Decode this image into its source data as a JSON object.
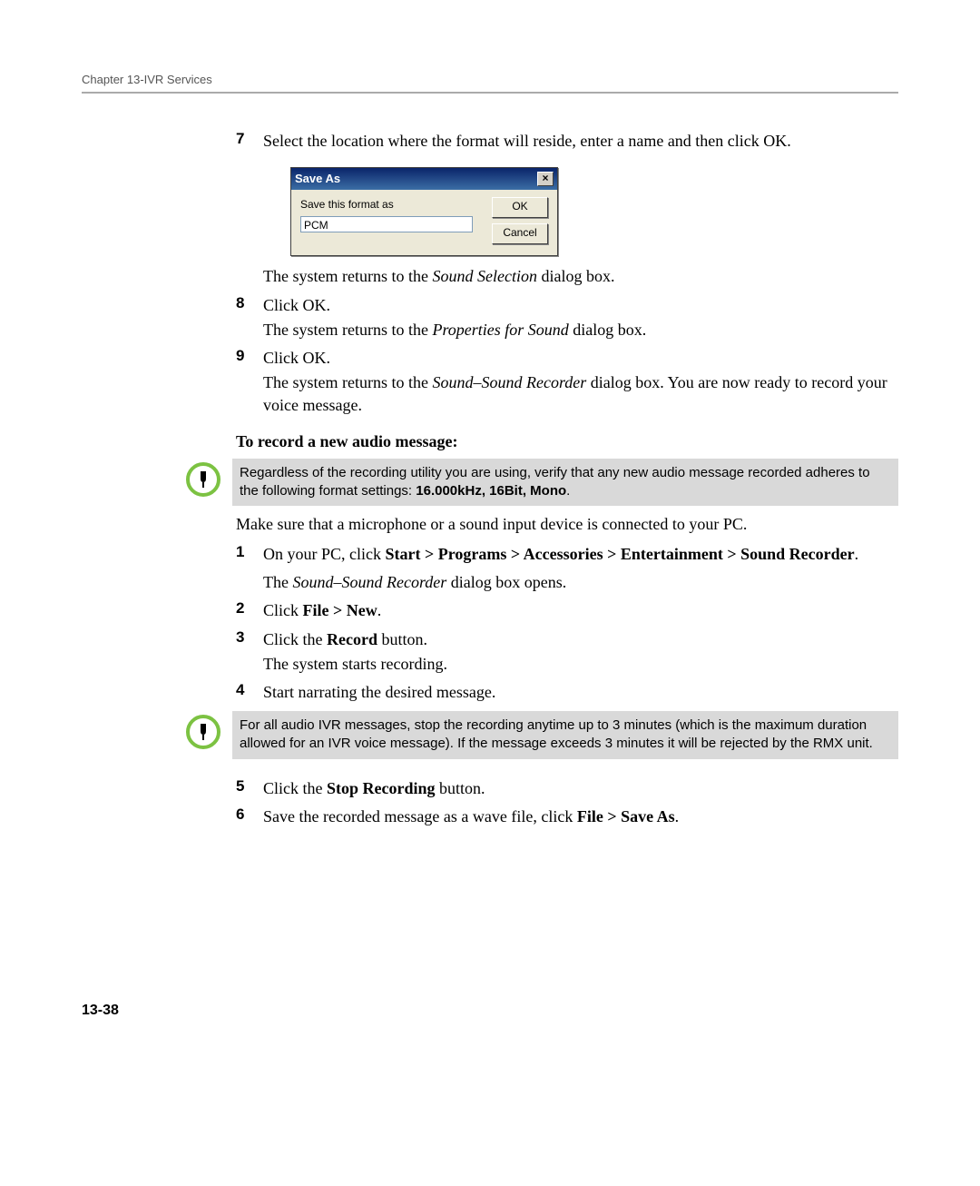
{
  "header": "Chapter 13-IVR Services",
  "step7": {
    "num": "7",
    "text": "Select the location where the format will reside, enter a name and then click OK."
  },
  "dialog": {
    "title": "Save As",
    "label": "Save this format as",
    "value": "PCM",
    "ok": "OK",
    "cancel": "Cancel"
  },
  "after7_a": "The system returns to the ",
  "after7_b": "Sound Selection",
  "after7_c": " dialog box.",
  "step8": {
    "num": "8",
    "l1": "Click OK.",
    "l2a": "The system returns to the ",
    "l2b": "Properties for Sound",
    "l2c": " dialog box."
  },
  "step9": {
    "num": "9",
    "l1": "Click OK.",
    "l2a": "The system returns to the ",
    "l2b": "Sound–Sound Recorder",
    "l2c": " dialog box. You are now ready to record your voice message."
  },
  "subhead1": "To record a new audio message:",
  "note1_a": "Regardless of the recording utility you are using, verify that any new audio message recorded adheres to the following format settings: ",
  "note1_b": "16.000kHz, 16Bit, Mono",
  "note1_c": ".",
  "para_mic": "Make sure that a microphone or a sound input device is connected to your PC.",
  "rec1": {
    "num": "1",
    "a": "On your PC, click ",
    "b": "Start > Programs > Accessories > Entertainment > Sound Recorder",
    "c": ".",
    "d_a": "The ",
    "d_b": "Sound–Sound Recorder",
    "d_c": " dialog box opens."
  },
  "rec2": {
    "num": "2",
    "a": "Click ",
    "b": "File > New",
    "c": "."
  },
  "rec3": {
    "num": "3",
    "a": "Click the ",
    "b": "Record",
    "c": " button.",
    "d": "The system starts recording."
  },
  "rec4": {
    "num": "4",
    "text": "Start narrating the desired message."
  },
  "note2": "For all audio IVR messages, stop the recording anytime up to 3 minutes (which is the maximum duration allowed for an IVR voice message). If the message exceeds 3 minutes it will be rejected by the RMX unit.",
  "rec5": {
    "num": "5",
    "a": "Click the ",
    "b": "Stop Recording",
    "c": " button."
  },
  "rec6": {
    "num": "6",
    "a": "Save the recorded message as a wave file, click ",
    "b": "File > Save As",
    "c": "."
  },
  "page": "13-38"
}
